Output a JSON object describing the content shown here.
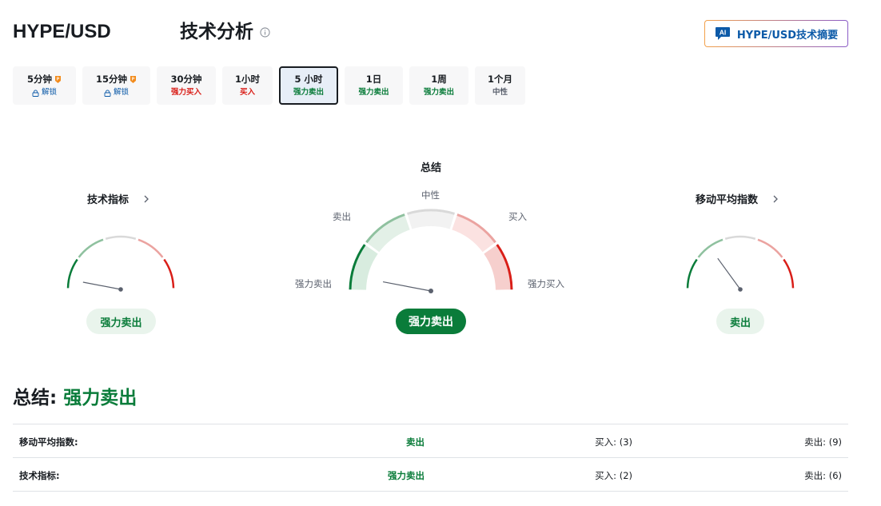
{
  "header": {
    "pair": "HYPE/USD",
    "title": "技术分析",
    "ai_button": "HYPE/USD技术摘要",
    "ai_badge": "AI"
  },
  "tabs": [
    {
      "name": "5分钟",
      "signal": "解锁",
      "locked": true,
      "width": 79
    },
    {
      "name": "15分钟",
      "signal": "解锁",
      "locked": true,
      "width": 85
    },
    {
      "name": "30分钟",
      "signal": "强力买入",
      "cls": "c-sb",
      "width": 74
    },
    {
      "name": "1小时",
      "signal": "买入",
      "cls": "c-b",
      "width": 63
    },
    {
      "name": "5 小时",
      "signal": "强力卖出",
      "cls": "c-ss",
      "active": true,
      "width": 74
    },
    {
      "name": "1日",
      "signal": "强力卖出",
      "cls": "c-ss",
      "width": 73
    },
    {
      "name": "1周",
      "signal": "强力卖出",
      "cls": "c-ss",
      "width": 74
    },
    {
      "name": "1个月",
      "signal": "中性",
      "cls": "c-n",
      "width": 63
    }
  ],
  "gauges": {
    "technical": {
      "title": "技术指标",
      "result": "强力卖出",
      "level": 0.06
    },
    "summary": {
      "title": "总结",
      "result": "强力卖出",
      "level": 0.06,
      "labels": {
        "strong_sell": "强力卖出",
        "sell": "卖出",
        "neutral": "中性",
        "buy": "买入",
        "strong_buy": "强力买入"
      }
    },
    "moving_averages": {
      "title": "移动平均指数",
      "result": "卖出",
      "level": 0.3
    }
  },
  "summary": {
    "label": "总结:",
    "value": "强力卖出"
  },
  "table": [
    {
      "name": "移动平均指数:",
      "signal": "卖出",
      "buy": "买入: (3)",
      "sell": "卖出: (9)"
    },
    {
      "name": "技术指标:",
      "signal": "强力卖出",
      "buy": "买入: (2)",
      "sell": "卖出: (6)"
    }
  ],
  "colors": {
    "strong_sell": "#0a7c3a",
    "sell": "#8fc19f",
    "neutral": "#d9d9d9",
    "buy": "#eba3a0",
    "strong_buy": "#d91e18",
    "accent": "#0c5aa8"
  }
}
